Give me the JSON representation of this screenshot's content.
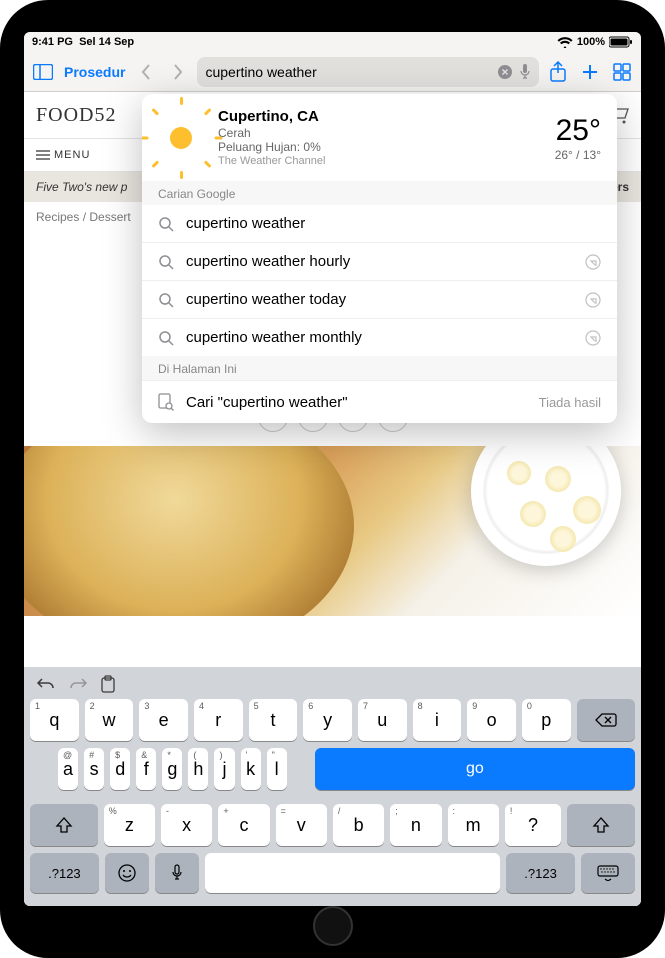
{
  "status": {
    "time": "9:41 PG",
    "date": "Sel 14 Sep"
  },
  "toolbar": {
    "sidebar_label": "Prosedur",
    "search_value": "cupertino weather"
  },
  "panel": {
    "weather": {
      "location": "Cupertino, CA",
      "condition": "Cerah",
      "rain": "Peluang Hujan: 0%",
      "source": "The Weather Channel",
      "temp_now": "25°",
      "temp_range": "26° / 13°"
    },
    "google_header": "Carian Google",
    "suggestions": [
      {
        "text": "cupertino weather",
        "has_arrow": false
      },
      {
        "text": "cupertino weather hourly",
        "has_arrow": true
      },
      {
        "text": "cupertino weather today",
        "has_arrow": true
      },
      {
        "text": "cupertino weather monthly",
        "has_arrow": true
      }
    ],
    "onpage_header": "Di Halaman Ini",
    "onpage_label": "Cari \"cupertino weather\"",
    "onpage_result": "Tiada hasil"
  },
  "page": {
    "logo": "FOOD52",
    "menu": "MENU",
    "promo_left": "Five Two's new p",
    "promo_right": "Orders",
    "crumbs": "Recipes / Dessert"
  },
  "keyboard": {
    "row1": [
      {
        "m": "q",
        "h": "1"
      },
      {
        "m": "w",
        "h": "2"
      },
      {
        "m": "e",
        "h": "3"
      },
      {
        "m": "r",
        "h": "4"
      },
      {
        "m": "t",
        "h": "5"
      },
      {
        "m": "y",
        "h": "6"
      },
      {
        "m": "u",
        "h": "7"
      },
      {
        "m": "i",
        "h": "8"
      },
      {
        "m": "o",
        "h": "9"
      },
      {
        "m": "p",
        "h": "0"
      }
    ],
    "row2": [
      {
        "m": "a",
        "h": "@"
      },
      {
        "m": "s",
        "h": "#"
      },
      {
        "m": "d",
        "h": "$"
      },
      {
        "m": "f",
        "h": "&"
      },
      {
        "m": "g",
        "h": "*"
      },
      {
        "m": "h",
        "h": "("
      },
      {
        "m": "j",
        "h": ")"
      },
      {
        "m": "k",
        "h": "'"
      },
      {
        "m": "l",
        "h": "\""
      }
    ],
    "row3": [
      {
        "m": "z",
        "h": "%"
      },
      {
        "m": "x",
        "h": "-"
      },
      {
        "m": "c",
        "h": "+"
      },
      {
        "m": "v",
        "h": "="
      },
      {
        "m": "b",
        "h": "/"
      },
      {
        "m": "n",
        "h": ";"
      },
      {
        "m": "m",
        "h": ":"
      }
    ],
    "go": "go",
    "numkey": ".?123",
    "comma": ",",
    "period": ".",
    "question": "!\n?"
  }
}
